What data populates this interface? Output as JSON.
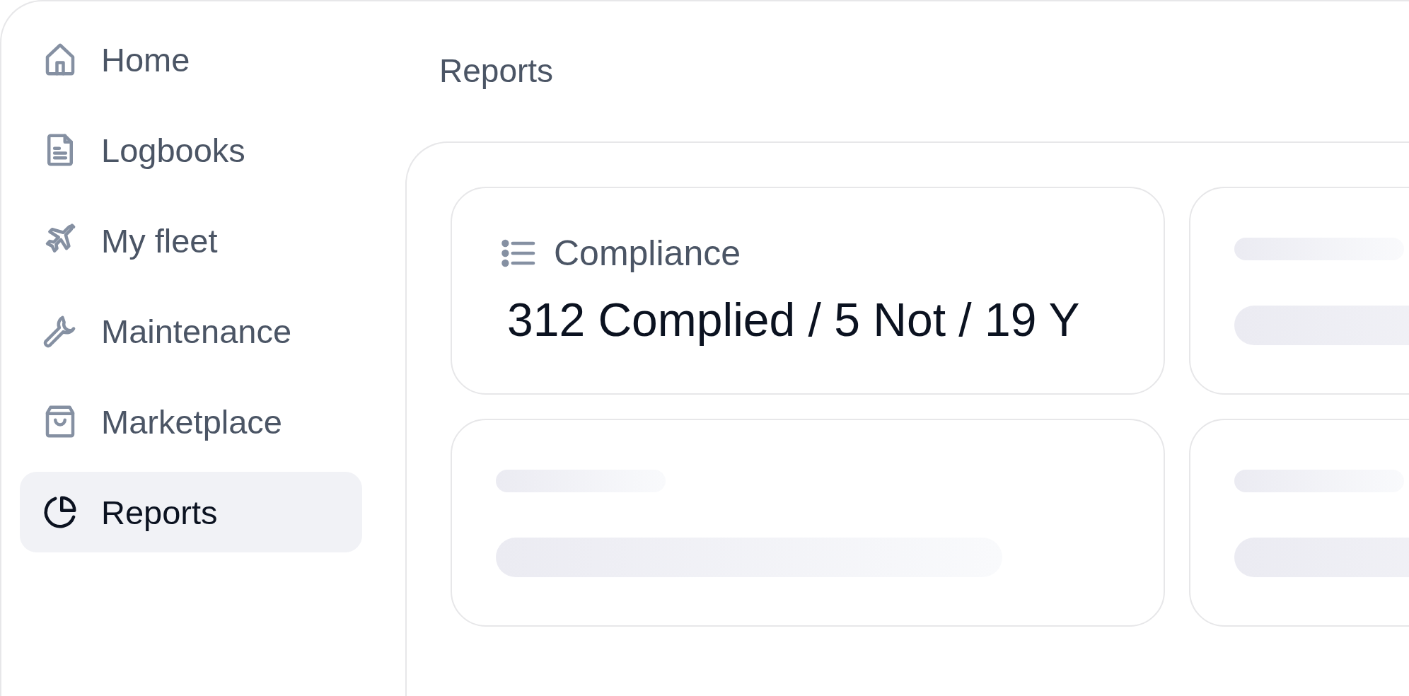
{
  "sidebar": {
    "items": [
      {
        "label": "Home",
        "selected": false
      },
      {
        "label": "Logbooks",
        "selected": false
      },
      {
        "label": "My fleet",
        "selected": false
      },
      {
        "label": "Maintenance",
        "selected": false
      },
      {
        "label": "Marketplace",
        "selected": false
      },
      {
        "label": "Reports",
        "selected": true
      }
    ]
  },
  "page_title": "Reports",
  "cards": [
    {
      "kind": "stat",
      "title": "Compliance",
      "value": "312 Complied / 5 Not / 19 Y"
    },
    {
      "kind": "skeleton"
    },
    {
      "kind": "skeleton"
    },
    {
      "kind": "skeleton"
    }
  ]
}
